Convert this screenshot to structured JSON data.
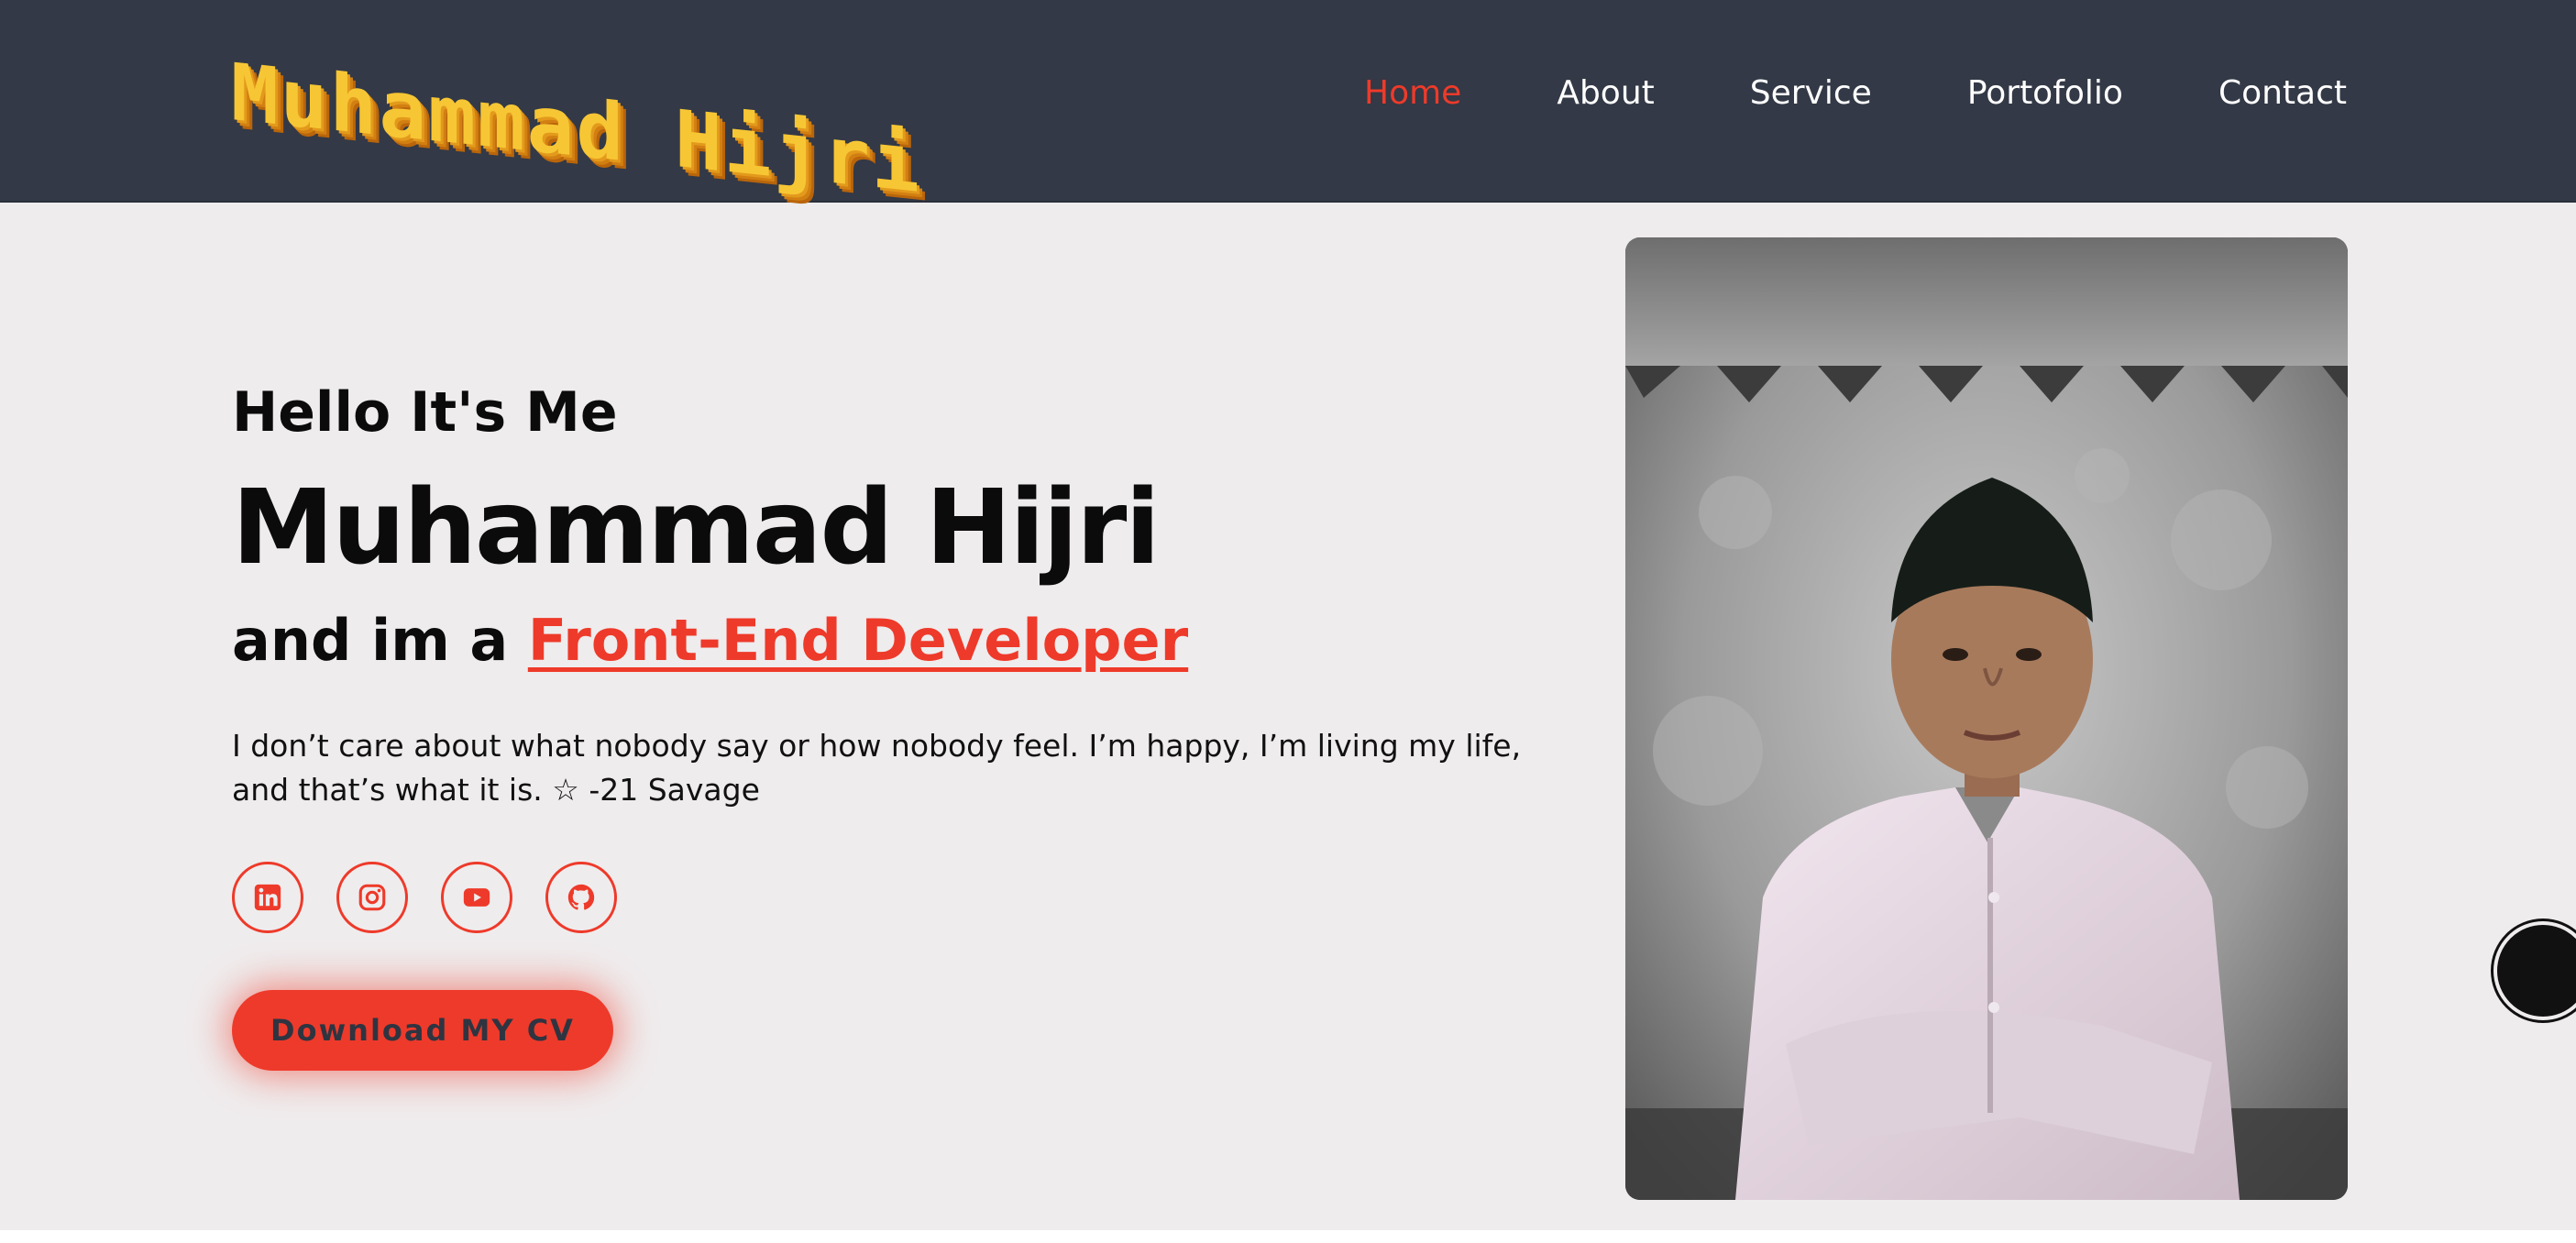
{
  "header": {
    "logo_text": "Muhammad Hijri",
    "nav": [
      {
        "label": "Home",
        "active": true
      },
      {
        "label": "About",
        "active": false
      },
      {
        "label": "Service",
        "active": false
      },
      {
        "label": "Portofolio",
        "active": false
      },
      {
        "label": "Contact",
        "active": false
      }
    ]
  },
  "hero": {
    "greeting": "Hello It's Me",
    "name": "Muhammad Hijri",
    "role_prefix": "and im a ",
    "role_highlight": "Front-End Developer",
    "quote": "I don’t care about what nobody say or how nobody feel. I’m happy, I’m living my life, and that’s what it is. ☆ -21 Savage",
    "cv_button": "Download MY CV"
  },
  "socials": [
    {
      "icon": "linkedin-icon"
    },
    {
      "icon": "instagram-icon"
    },
    {
      "icon": "youtube-icon"
    },
    {
      "icon": "github-icon"
    }
  ],
  "colors": {
    "accent": "#ee3a2a",
    "header_bg": "#333946",
    "page_bg": "#efeced",
    "logo": "#f7c634"
  }
}
